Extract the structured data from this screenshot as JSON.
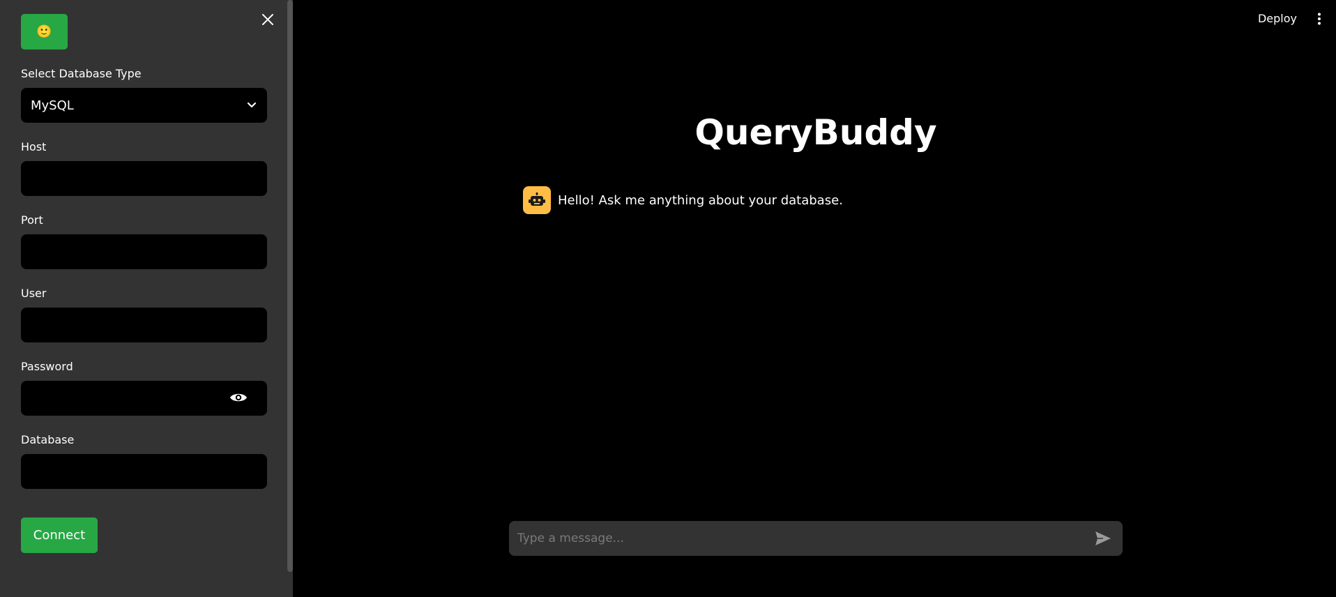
{
  "sidebar": {
    "logo_emoji": "🙂",
    "close_icon": "close-icon",
    "db_type": {
      "label": "Select Database Type",
      "selected": "MySQL"
    },
    "host": {
      "label": "Host",
      "value": ""
    },
    "port": {
      "label": "Port",
      "value": ""
    },
    "user": {
      "label": "User",
      "value": ""
    },
    "password": {
      "label": "Password",
      "value": ""
    },
    "database": {
      "label": "Database",
      "value": ""
    },
    "connect_label": "Connect"
  },
  "header": {
    "deploy_label": "Deploy",
    "menu_icon": "more-vertical-icon"
  },
  "main": {
    "title": "QueryBuddy",
    "messages": [
      {
        "role": "assistant",
        "avatar_icon": "robot-icon",
        "text": "Hello! Ask me anything about your database."
      }
    ],
    "chat_input": {
      "placeholder": "Type a message...",
      "send_icon": "send-icon"
    }
  },
  "colors": {
    "sidebar_bg": "#333333",
    "main_bg": "#000000",
    "accent_green": "#28a745",
    "avatar_yellow": "#ffbd45"
  }
}
